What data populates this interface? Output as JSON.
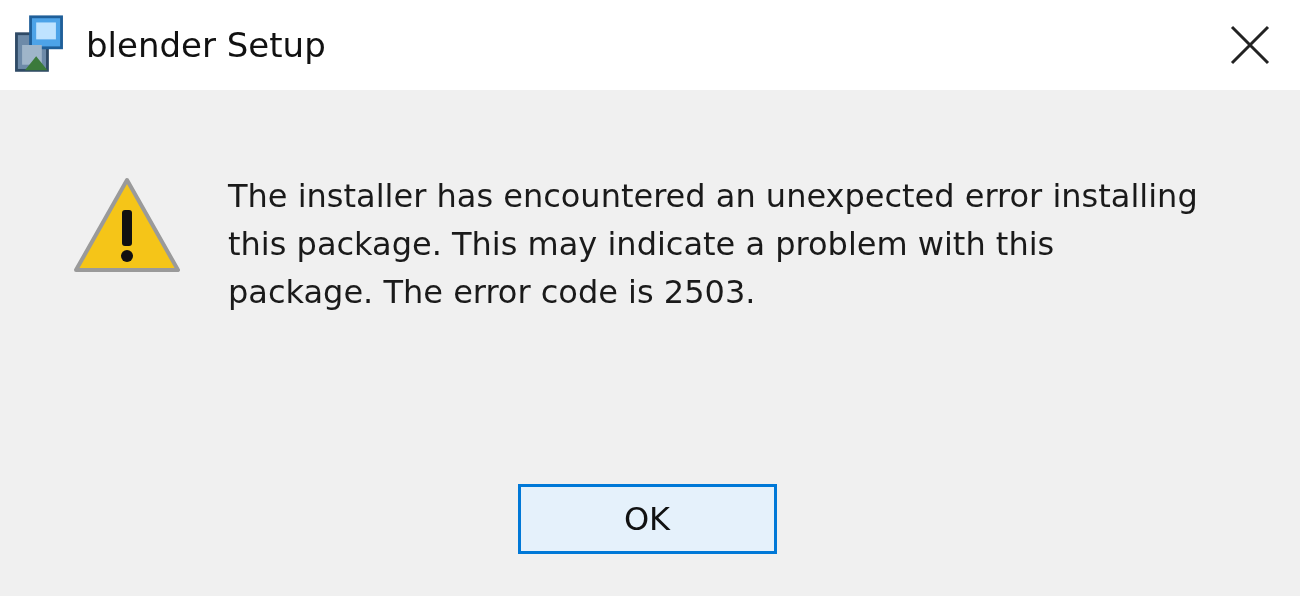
{
  "window": {
    "title": "blender Setup"
  },
  "message": "The installer has encountered an unexpected error installing this package. This may indicate a problem with this package. The error code is 2503.",
  "buttons": [
    {
      "label": "OK",
      "selected": true
    }
  ]
}
